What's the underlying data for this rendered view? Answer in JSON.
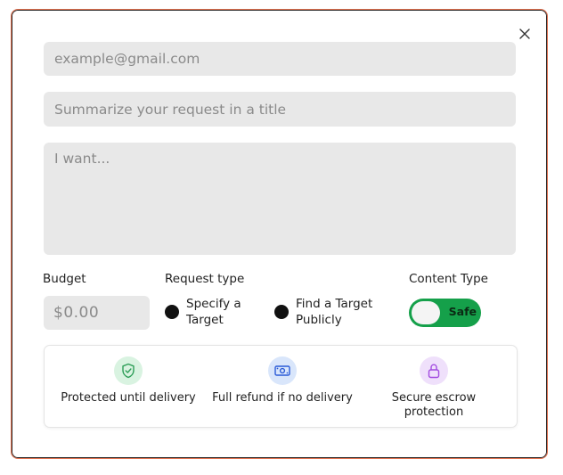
{
  "form": {
    "email_placeholder": "example@gmail.com",
    "title_placeholder": "Summarize your request in a title",
    "description_placeholder": "I want..."
  },
  "budget": {
    "label": "Budget",
    "currency": "$",
    "placeholder": "0.00"
  },
  "request_type": {
    "label": "Request type",
    "options": [
      "Specify a Target",
      "Find a Target Publicly"
    ]
  },
  "content_type": {
    "label": "Content Type",
    "toggle_label": "Safe",
    "toggle_on": true
  },
  "guarantees": [
    {
      "icon": "shield-check-icon",
      "text": "Protected until delivery"
    },
    {
      "icon": "money-refund-icon",
      "text": "Full refund if no delivery"
    },
    {
      "icon": "lock-icon",
      "text": "Secure escrow protection"
    }
  ],
  "colors": {
    "modal_border": "#e0704f",
    "toggle_on": "#15a04a",
    "field_bg": "#e8e8e8",
    "shield_icon": "#2e9e58",
    "money_icon": "#2b5bd7",
    "lock_icon": "#a24be0"
  }
}
